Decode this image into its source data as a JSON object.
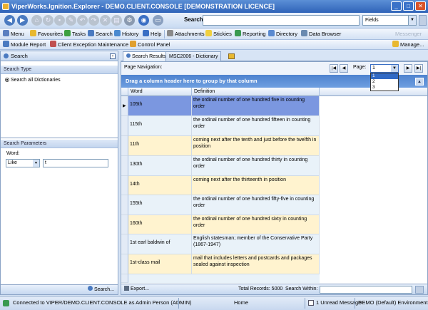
{
  "window": {
    "title": "ViperWorks.Ignition.Explorer - DEMO.CLIENT.CONSOLE [DEMONSTRATION LICENCE]"
  },
  "toolbar": {
    "search_label": "Search:",
    "search_value": "",
    "fields_value": "Fields"
  },
  "menubar": {
    "items": [
      {
        "label": "Menu",
        "icon": "menu-icon",
        "color": "#5a7fc0"
      },
      {
        "label": "Favourites",
        "icon": "star-icon",
        "color": "#e8b830"
      },
      {
        "label": "Tasks",
        "icon": "check-icon",
        "color": "#3da040"
      },
      {
        "label": "Search",
        "icon": "search-icon",
        "color": "#4a7ac0"
      },
      {
        "label": "History",
        "icon": "history-icon",
        "color": "#4a8ad0"
      },
      {
        "label": "Help",
        "icon": "help-icon",
        "color": "#3a6fc4"
      },
      {
        "label": "Attachments",
        "icon": "paperclip-icon",
        "color": "#8a8a8a"
      },
      {
        "label": "Stickies",
        "icon": "sticky-note-icon",
        "color": "#f0d040"
      },
      {
        "label": "Reporting",
        "icon": "chart-icon",
        "color": "#3a9a50"
      },
      {
        "label": "Directory",
        "icon": "directory-icon",
        "color": "#5a8ad0"
      },
      {
        "label": "Data Browser",
        "icon": "grid-icon",
        "color": "#6a8ab0"
      }
    ],
    "disabled_item": "Messenger"
  },
  "linkbar": {
    "items": [
      {
        "label": "Module Report",
        "icon": "report-icon",
        "color": "#4a7ac0"
      },
      {
        "label": "Client Exception Maintenance",
        "icon": "user-icon",
        "color": "#c05050"
      },
      {
        "label": "Control Panel",
        "icon": "control-panel-icon",
        "color": "#e0a030"
      }
    ],
    "manage_label": "Manage..."
  },
  "left": {
    "header": "Search",
    "search_type_header": "Search Type",
    "search_type_option": "Search all Dictionaries",
    "params_header": "Search Parameters",
    "word_label": "Word:",
    "operator_value": "Like",
    "word_value": "t",
    "search_button": "Search..."
  },
  "tabs": [
    {
      "label": "Search Results"
    },
    {
      "label": "MSC2006 - Dictionary"
    }
  ],
  "nav": {
    "label": "Page Navigation:",
    "page_label": "Page:",
    "page_value": "1",
    "page_options": [
      "1",
      "2",
      "3"
    ]
  },
  "grid": {
    "group_hint": "Drag a column header here to group by that column",
    "columns": [
      "Word",
      "Definition"
    ],
    "rows": [
      {
        "word": "105th",
        "definition": "the ordinal number of one hundred five in counting order"
      },
      {
        "word": "115th",
        "definition": "the ordinal number of one hundred fifteen in counting order"
      },
      {
        "word": "11th",
        "definition": "coming next after the tenth and just before the twelfth in position"
      },
      {
        "word": "130th",
        "definition": "the ordinal number of one hundred thirty in counting order"
      },
      {
        "word": "14th",
        "definition": "coming next after the thirteenth in position"
      },
      {
        "word": "155th",
        "definition": "the ordinal number of one hundred fifty-five in counting order"
      },
      {
        "word": "160th",
        "definition": "the ordinal number of one hundred sixty in counting order"
      },
      {
        "word": "1st earl baldwin of bewdley",
        "definition": "English statesman; member of the Conservative Party (1867-1947)"
      },
      {
        "word": "1st-class mail",
        "definition": "mail that includes letters and postcards and packages sealed against inspection"
      }
    ]
  },
  "footer": {
    "export_label": "Export...",
    "total_records": "Total Records: 5000",
    "search_within_label": "Search Within:"
  },
  "status": {
    "connection": "Connected to VIPER/DEMO.CLIENT.CONSOLE as Admin Person (ADMIN)",
    "home": "Home",
    "messages": "1 Unread Message",
    "environment": "DEMO (Default) Environment"
  }
}
